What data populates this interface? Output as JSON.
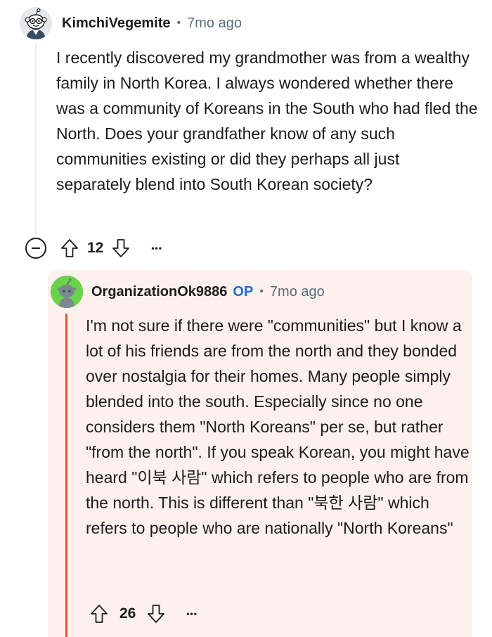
{
  "thread": {
    "parent_comment": {
      "avatar_icon": "snoo-avatar-icon",
      "username": "KimchiVegemite",
      "separator": "•",
      "age": "7mo ago",
      "body": "I recently discovered my grandmother was from a wealthy family in North Korea. I always wondered whether there was a community of Koreans in the South who had fled the North. Does your grandfather know of any such communities existing or did they perhaps all just separately blend into South Korean society?",
      "score": "12",
      "more_label": "•••",
      "collapse_icon": "collapse-minus-icon"
    },
    "reply": {
      "avatar_icon": "snoo-avatar-icon",
      "username": "OrganizationOk9886",
      "op_badge": "OP",
      "separator": "•",
      "age": "7mo ago",
      "body": "I'm not sure if there were \"communities\" but I know a lot of his friends are from the north and they bonded over nostalgia for their homes. Many people simply blended into the south. Especially since no one considers them \"North Koreans\" per se, but rather \"from the north\". If you speak Korean, you might have heard \"이북 사람\" which refers to people who are from the north. This is different than \"북한 사람\" which refers to people who are nationally \"North Koreans\"",
      "score": "26",
      "more_label": "•••"
    }
  },
  "colors": {
    "reply_background": "#fdf1ee",
    "reply_thread_line": "#e0572b",
    "op_badge": "#1f6fd1",
    "reply_avatar": "#6bd34a",
    "meta_gray": "#576f76"
  }
}
